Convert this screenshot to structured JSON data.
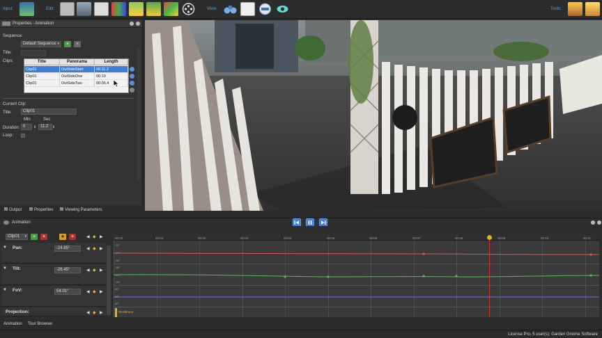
{
  "toolbar": {
    "input_label": "Input:",
    "edit_label": "Edit:",
    "view_label": "View:",
    "tools_label": "Tools:"
  },
  "properties": {
    "title": "Properties - Animation",
    "sequence_label": "Sequence:",
    "sequence_value": "Default Sequence",
    "title_label": "Title:",
    "clips_label": "Clips:",
    "columns": [
      "Title",
      "Panorama",
      "Length"
    ],
    "clips": [
      {
        "title": "Clip01",
        "panorama": "OutSideStart",
        "length": "00:11.2"
      },
      {
        "title": "Clip01",
        "panorama": "OutSideOne",
        "length": "00:10"
      },
      {
        "title": "Clip01",
        "panorama": "OutSideTwo",
        "length": "00:06.4"
      }
    ],
    "current_clip_label": "Current Clip:",
    "clip_title_label": "Title:",
    "clip_title_value": "Clip01",
    "min_label": "Min",
    "sec_label": "Sec",
    "duration_label": "Duration:",
    "duration_min": "0",
    "duration_sec": "11.2",
    "loop_label": "Loop:"
  },
  "panel_tabs": [
    "Output",
    "Properties",
    "Viewing Parameters"
  ],
  "animation": {
    "title": "Animation",
    "clip_select": "Clip01",
    "tracks": [
      {
        "name": "Pan:",
        "value": "-24.85°"
      },
      {
        "name": "Tilt:",
        "value": "-26.45°"
      },
      {
        "name": "FoV:",
        "value": "54.01°"
      },
      {
        "name": "Projection:",
        "value": ""
      }
    ],
    "projection_key": "Rectilinear",
    "ticks": [
      "00:00",
      "00:01",
      "00:02",
      "00:03",
      "00:04",
      "00:05",
      "00:06",
      "00:07",
      "00:08",
      "00:09",
      "00:10",
      "00:11"
    ],
    "pan_axis": [
      "-22°",
      "-24°",
      "-26°"
    ],
    "tilt_axis": [
      "-30°",
      "-25°",
      "-20°"
    ],
    "fov_axis": [
      "60°",
      "55°",
      "50°"
    ]
  },
  "bottom_tabs": [
    "Animation",
    "Tour Browser"
  ],
  "status": "License Pro, 5 user(s): Garden Gnome Software",
  "colors": {
    "accent": "#3d7fd4",
    "pan_curve": "#e05050",
    "tilt_curve": "#50c050",
    "fov_curve": "#5a6ee0",
    "playhead": "#d03030"
  }
}
